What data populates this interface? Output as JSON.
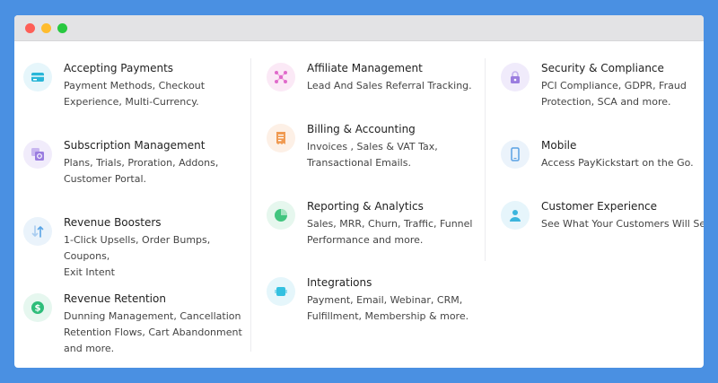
{
  "window": {
    "controls": {
      "close_color": "#fe5f57",
      "minimize_color": "#febc2e",
      "maximize_color": "#28c840"
    }
  },
  "colors": {
    "payments_bg": "#e6f6fb",
    "payments_icon": "#29b6d8",
    "subscription_bg": "#f1ecfb",
    "subscription_icon": "#9a7de0",
    "boosters_bg": "#eaf3fb",
    "boosters_icon": "#5aa5e6",
    "retention_bg": "#e6f7ef",
    "retention_icon": "#2ebd7a",
    "affiliate_bg": "#fbe9f6",
    "affiliate_icon": "#e06acb",
    "billing_bg": "#fdf0e6",
    "billing_icon": "#f09a52",
    "reporting_bg": "#e6f7ee",
    "reporting_icon": "#42c57f",
    "integrations_bg": "#e5f6fb",
    "integrations_icon": "#33c0e0",
    "security_bg": "#f0ebfb",
    "security_icon": "#9b7ddf",
    "mobile_bg": "#ebf3fb",
    "mobile_icon": "#5aa1e3",
    "experience_bg": "#e6f5fb",
    "experience_icon": "#3bb5dd"
  },
  "features": {
    "payments": {
      "title": "Accepting Payments",
      "line1": "Payment Methods, Checkout",
      "line2": "Experience, Multi-Currency."
    },
    "subscription": {
      "title": "Subscription Management",
      "line1": "Plans, Trials, Proration, Addons,",
      "line2": "Customer Portal."
    },
    "boosters": {
      "title": "Revenue Boosters",
      "line1": "1-Click Upsells, Order Bumps, Coupons,",
      "line2": "Exit Intent"
    },
    "retention": {
      "title": "Revenue Retention",
      "line1": "Dunning Management, Cancellation",
      "line2": "Retention Flows, Cart Abandonment",
      "line3": "and more."
    },
    "affiliate": {
      "title": "Affiliate Management",
      "line1": "Lead And Sales Referral Tracking."
    },
    "billing": {
      "title": "Billing & Accounting",
      "line1": "Invoices , Sales & VAT Tax,",
      "line2": "Transactional Emails."
    },
    "reporting": {
      "title": "Reporting & Analytics",
      "line1": "Sales, MRR, Churn, Traffic, Funnel",
      "line2": "Performance and more."
    },
    "integrations": {
      "title": "Integrations",
      "line1": "Payment, Email, Webinar, CRM,",
      "line2": "Fulfillment, Membership & more."
    },
    "security": {
      "title": "Security & Compliance",
      "line1": "PCI Compliance, GDPR, Fraud",
      "line2": "Protection, SCA and more."
    },
    "mobile": {
      "title": "Mobile",
      "line1": "Access PayKickstart on the Go."
    },
    "experience": {
      "title": "Customer Experience",
      "line1": "See What Your Customers Will See."
    }
  },
  "icons": {
    "payments": "credit-card-icon",
    "subscription": "subscription-stack-icon",
    "boosters": "up-down-arrows-icon",
    "retention": "dollar-coin-icon",
    "affiliate": "network-nodes-icon",
    "billing": "invoice-document-icon",
    "reporting": "pie-chart-icon",
    "integrations": "integration-square-icon",
    "security": "padlock-icon",
    "mobile": "smartphone-icon",
    "experience": "user-person-icon"
  }
}
